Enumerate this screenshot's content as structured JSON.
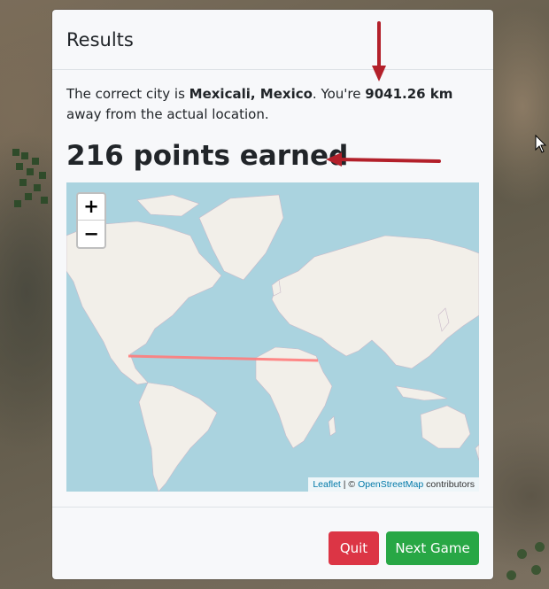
{
  "modal": {
    "title": "Results",
    "result_prefix": "The correct city is ",
    "city": "Mexicali, Mexico",
    "result_mid": ". You're ",
    "distance": "9041.26 km",
    "result_suffix": " away from the actual location.",
    "points_heading": "216 points earned"
  },
  "map": {
    "zoom_in_label": "+",
    "zoom_out_label": "−",
    "attribution": {
      "leaflet_link": "Leaflet",
      "separator": " | © ",
      "osm_link": "OpenStreetMap",
      "suffix": " contributors"
    },
    "line_color": "#ff7b7b"
  },
  "footer": {
    "quit_label": "Quit",
    "next_game_label": "Next Game"
  },
  "colors": {
    "quit": "#dc3545",
    "next_game": "#28a745",
    "annotation_arrow": "#b3202a",
    "ocean": "#aad3df",
    "land": "#f2efe9"
  }
}
